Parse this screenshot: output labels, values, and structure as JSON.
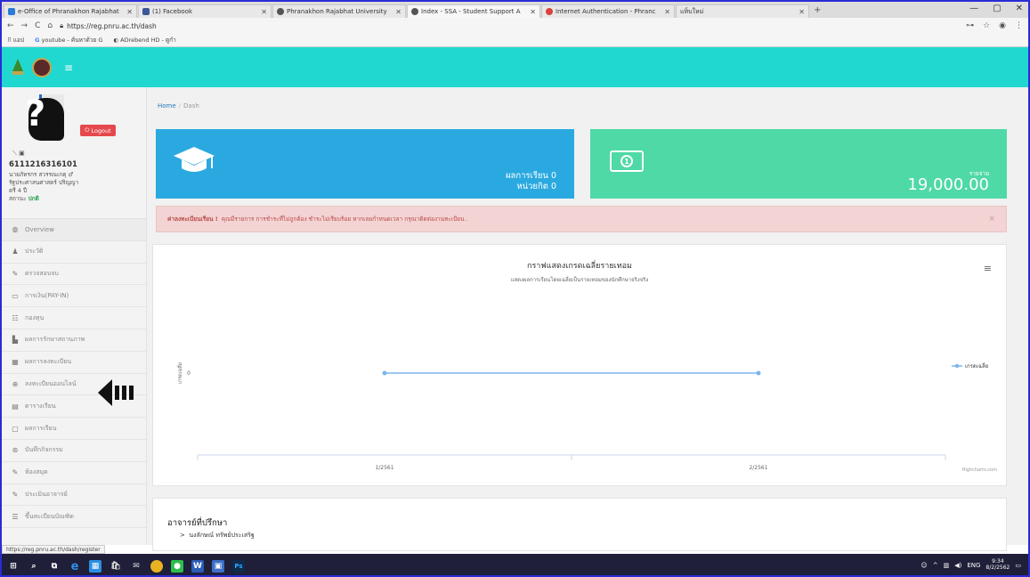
{
  "browser": {
    "tabs": [
      {
        "label": "e-Office of Phranakhon Rajabhat",
        "color": "#2a7ad8",
        "active": false
      },
      {
        "label": "(1) Facebook",
        "color": "#3b5998",
        "active": false
      },
      {
        "label": "Phranakhon Rajabhat University",
        "color": "#555555",
        "active": false
      },
      {
        "label": "Index - SSA - Student Support A",
        "color": "#555555",
        "active": true
      },
      {
        "label": "Internet Authentication - Phranc",
        "color": "#d9433b",
        "active": false
      },
      {
        "label": "แท็บใหม่",
        "color": "#bbbbbb",
        "active": false
      }
    ],
    "url": "https://reg.pnru.ac.th/dash",
    "bookmarks": [
      "แอป",
      "youtube - ค้นหาด้วย G",
      "ADrebend HD - ดูกำ"
    ]
  },
  "sidebar": {
    "student_id": "6111216316101",
    "profile_lines": [
      "นายภัทรกร สวรรณเกตุ ♂",
      "รัฐประศาสนศาสตร์ ปริญญา",
      "ตรี 4 ปี"
    ],
    "status_label": "สถานะ",
    "status_value": "ปกติ",
    "logout_label": "Logout",
    "menu": [
      {
        "icon": "◍",
        "label": "Overview"
      },
      {
        "icon": "♟",
        "label": "ประวัติ"
      },
      {
        "icon": "✎",
        "label": "ตรวจสอบจบ"
      },
      {
        "icon": "▭",
        "label": "การเงิน(PAY-IN)"
      },
      {
        "icon": "☷",
        "label": "กองทุน"
      },
      {
        "icon": "▙",
        "label": "ผลการรักษาสถานภาพ"
      },
      {
        "icon": "▦",
        "label": "ผลการลงทะเบียน"
      },
      {
        "icon": "⊕",
        "label": "ลงทะเบียนออนไลน์"
      },
      {
        "icon": "▤",
        "label": "ตารางเรียน"
      },
      {
        "icon": "▢",
        "label": "ผลการเรียน"
      },
      {
        "icon": "⊛",
        "label": "บันทึกกิจกรรม"
      },
      {
        "icon": "✎",
        "label": "ห้องสมุด"
      },
      {
        "icon": "✎",
        "label": "ประเมินอาจารย์"
      },
      {
        "icon": "☰",
        "label": "ขึ้นทะเบียนบัณฑิต"
      }
    ]
  },
  "breadcrumb": {
    "home": "Home",
    "separator": "/",
    "current": "Dash"
  },
  "cards": {
    "grade": {
      "line1": "ผลการเรียน 0",
      "line2": "หน่วยกิต 0"
    },
    "payment": {
      "label": "รายจ่าย",
      "value": "19,000.00"
    }
  },
  "alert": {
    "bold": "ค่าลงทะเบียนเรียน !",
    "text": "คุณมีรายการ การชำระที่ไม่ถูกต้อง ชำระไม่เรียบร้อย หากเลยกำหนดเวลา กรุณาติดต่องานทะเบียน ."
  },
  "chart_card": {
    "menu_icon": "≡",
    "credits": "Highcharts.com"
  },
  "chart_data": {
    "type": "line",
    "title": "กราฟแสดงเกรดเฉลี่ยรายเทอม",
    "subtitle": "แสดงผลการเรียนโดยเฉลี่ยเป็นรายเทอมของนักศึกษาจริงจริง",
    "ylabel": "เกรดเฉลี่ย",
    "categories": [
      "1/2561",
      "2/2561"
    ],
    "series": [
      {
        "name": "เกรดเฉลี่ย",
        "values": [
          0,
          0
        ],
        "color": "#7cb5ec"
      }
    ],
    "yticks": [
      "0"
    ],
    "legend": "right"
  },
  "advisor": {
    "title": "อาจารย์ที่ปรึกษา",
    "bullet": ">",
    "name": "นงลักษณ์ ทรัพย์ประเสริฐ"
  },
  "status_url": "https://reg.pnru.ac.th/dash/register",
  "taskbar": {
    "lang": "ENG",
    "time": "9:34",
    "date": "8/2/2562"
  }
}
